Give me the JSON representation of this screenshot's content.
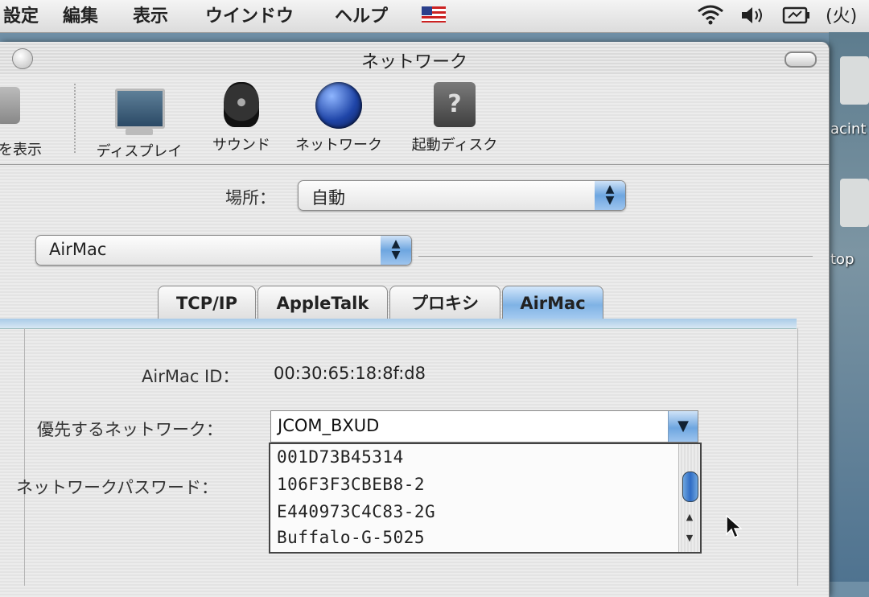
{
  "menubar": {
    "items": [
      "設定",
      "編集",
      "表示",
      "ウインドウ",
      "ヘルプ"
    ],
    "flag": "us-flag-icon",
    "status_day": "(火)"
  },
  "window": {
    "title": "ネットワーク"
  },
  "toolbar": {
    "items": [
      {
        "label": "を表示",
        "icon": "apple-icon"
      },
      {
        "label": "ディスプレイ",
        "icon": "display-icon"
      },
      {
        "label": "サウンド",
        "icon": "speaker-icon"
      },
      {
        "label": "ネットワーク",
        "icon": "globe-icon"
      },
      {
        "label": "起動ディスク",
        "icon": "disk-icon"
      }
    ]
  },
  "location": {
    "label": "場所：",
    "value": "自動"
  },
  "show": {
    "value": "AirMac"
  },
  "tabs": [
    {
      "label": "TCP/IP",
      "active": false
    },
    {
      "label": "AppleTalk",
      "active": false
    },
    {
      "label": "プロキシ",
      "active": false
    },
    {
      "label": "AirMac",
      "active": true
    }
  ],
  "airmac": {
    "id_label": "AirMac ID：",
    "id_value": "00:30:65:18:8f:d8",
    "preferred_label": "優先するネットワーク：",
    "preferred_value": "JCOM_BXUD",
    "password_label": "ネットワークパスワード：",
    "networks": [
      "001D73B45314",
      "106F3F3CBEB8-2",
      "E440973C4C83-2G",
      "Buffalo-G-5025"
    ]
  },
  "desktop": {
    "labels": [
      "acint",
      "top"
    ]
  },
  "colors": {
    "accent": "#6ea6e0",
    "window_bg": "#e8e8e8"
  }
}
